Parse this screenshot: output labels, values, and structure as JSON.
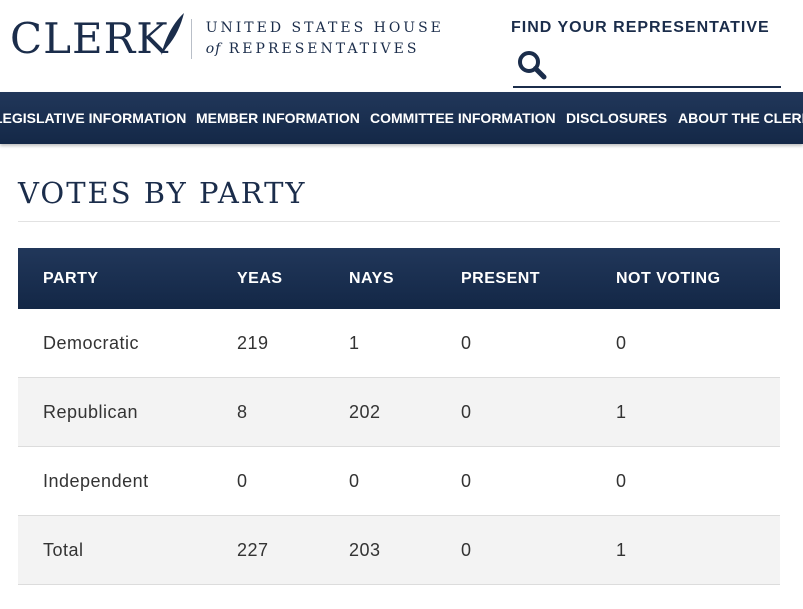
{
  "header": {
    "logo_main": "CLERK",
    "logo_line1": "UNITED STATES HOUSE",
    "logo_of": "of",
    "logo_line2": "REPRESENTATIVES",
    "find_rep_label": "FIND YOUR REPRESENTATIVE",
    "search_icon": "search-icon",
    "search_value": "",
    "search_placeholder": ""
  },
  "nav": {
    "items": [
      {
        "label": "LEGISLATIVE INFORMATION"
      },
      {
        "label": "MEMBER INFORMATION"
      },
      {
        "label": "COMMITTEE INFORMATION"
      },
      {
        "label": "DISCLOSURES"
      },
      {
        "label": "ABOUT THE CLERK"
      }
    ]
  },
  "main": {
    "title": "VOTES BY PARTY",
    "table": {
      "columns": [
        "PARTY",
        "YEAS",
        "NAYS",
        "PRESENT",
        "NOT VOTING"
      ],
      "rows": [
        [
          "Democratic",
          "219",
          "1",
          "0",
          "0"
        ],
        [
          "Republican",
          "8",
          "202",
          "0",
          "1"
        ],
        [
          "Independent",
          "0",
          "0",
          "0",
          "0"
        ],
        [
          "Total",
          "227",
          "203",
          "0",
          "1"
        ]
      ]
    }
  },
  "colors": {
    "brand_navy": "#1b2d4b",
    "nav_bg": "#1a2f51",
    "row_alt": "#f3f3f3"
  }
}
